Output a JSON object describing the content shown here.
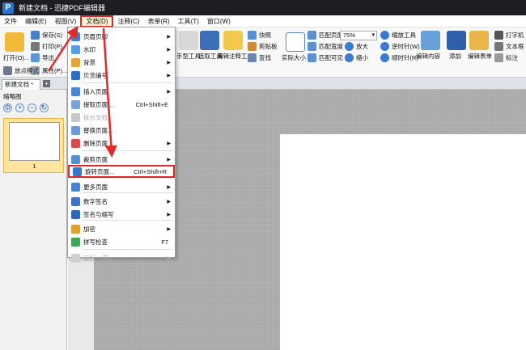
{
  "window": {
    "title": "新建文档 - 迅捷PDF编辑器",
    "logo_letter": "P"
  },
  "menubar": {
    "items": [
      "文件",
      "编辑(E)",
      "视图(V)",
      "文档(D)",
      "注释(C)",
      "表单(R)",
      "工具(T)",
      "窗口(W)"
    ],
    "active_index": 3
  },
  "ribbon": {
    "open": "打开(O)...",
    "save": "保存(S)",
    "print": "打印(P)",
    "export": "导出",
    "properties": "属性(P)...",
    "zoom_mode": "放点模式",
    "hand_tool": "手型工具",
    "select_tool": "选取工具",
    "comment_tool": "编辑注释工具",
    "snapshot": "快照",
    "clipboard": "剪贴板",
    "find": "查找",
    "actual_size": "实际大小",
    "fit_page": "匹配页面",
    "fit_width": "匹配宽度",
    "fit_visible": "匹配可见",
    "zoom_value": "75%",
    "zoom_in": "放大",
    "zoom_out": "缩小",
    "zoom_tool": "缩放工具",
    "rotate_cw": "逆时针(W)",
    "rotate_ccw": "顺时针(R)",
    "edit_content": "编辑内容",
    "add": "添加",
    "edit_form": "编辑表单",
    "typewriter": "打字机",
    "textbox": "文本框",
    "callout": "标注"
  },
  "tabs": {
    "doc_tab": "新建文档 *",
    "new_tab": "+"
  },
  "thumbnails": {
    "title": "缩略图",
    "page_number": "1"
  },
  "document_menu": {
    "items": [
      {
        "label": "页眉页脚",
        "shortcut": "",
        "submenu": true,
        "disabled": false,
        "icon_color": "#3d7fd6"
      },
      {
        "label": "水印",
        "shortcut": "",
        "submenu": true,
        "disabled": false,
        "icon_color": "#5a9be0"
      },
      {
        "label": "背景",
        "shortcut": "",
        "submenu": true,
        "disabled": false,
        "icon_color": "#e6a23c"
      },
      {
        "label": "贝茨编号",
        "shortcut": "",
        "submenu": true,
        "disabled": false,
        "icon_color": "#2f6fc2"
      },
      {
        "label": "插入页面",
        "shortcut": "",
        "submenu": true,
        "disabled": false,
        "icon_color": "#4a86d4"
      },
      {
        "label": "提取页面...",
        "shortcut": "Ctrl+Shift+E",
        "submenu": false,
        "disabled": false,
        "icon_color": "#7aa6dd"
      },
      {
        "label": "拆分文档...",
        "shortcut": "",
        "submenu": false,
        "disabled": true,
        "icon_color": "#c8c8c8"
      },
      {
        "label": "替换页面...",
        "shortcut": "",
        "submenu": false,
        "disabled": false,
        "icon_color": "#6c9ad8"
      },
      {
        "label": "删除页面",
        "shortcut": "",
        "submenu": true,
        "disabled": false,
        "icon_color": "#d94a4a"
      },
      {
        "label": "裁剪页面",
        "shortcut": "",
        "submenu": true,
        "disabled": false,
        "icon_color": "#5a8fcf"
      },
      {
        "label": "旋转页面...",
        "shortcut": "Ctrl+Shift+R",
        "submenu": false,
        "disabled": false,
        "icon_color": "#3a78cc",
        "highlighted": true
      },
      {
        "label": "更多页面",
        "shortcut": "",
        "submenu": true,
        "disabled": false,
        "icon_color": "#4b83cf"
      },
      {
        "label": "数字签名",
        "shortcut": "",
        "submenu": true,
        "disabled": false,
        "icon_color": "#3f74c4"
      },
      {
        "label": "签名与缩写",
        "shortcut": "",
        "submenu": true,
        "disabled": false,
        "icon_color": "#2f66b8"
      },
      {
        "label": "加密",
        "shortcut": "",
        "submenu": true,
        "disabled": false,
        "icon_color": "#e0a030"
      },
      {
        "label": "拼写检查",
        "shortcut": "F7",
        "submenu": false,
        "disabled": false,
        "icon_color": "#3aa655"
      },
      {
        "label": "运行: <无>",
        "shortcut": "",
        "submenu": true,
        "disabled": true,
        "icon_color": "#cfcfcf"
      }
    ]
  },
  "colors": {
    "highlight_border": "#e02a2a",
    "selection_fill": "#fde5a0",
    "titlebar": "#1e1e22",
    "canvas": "#a9a9a9"
  }
}
